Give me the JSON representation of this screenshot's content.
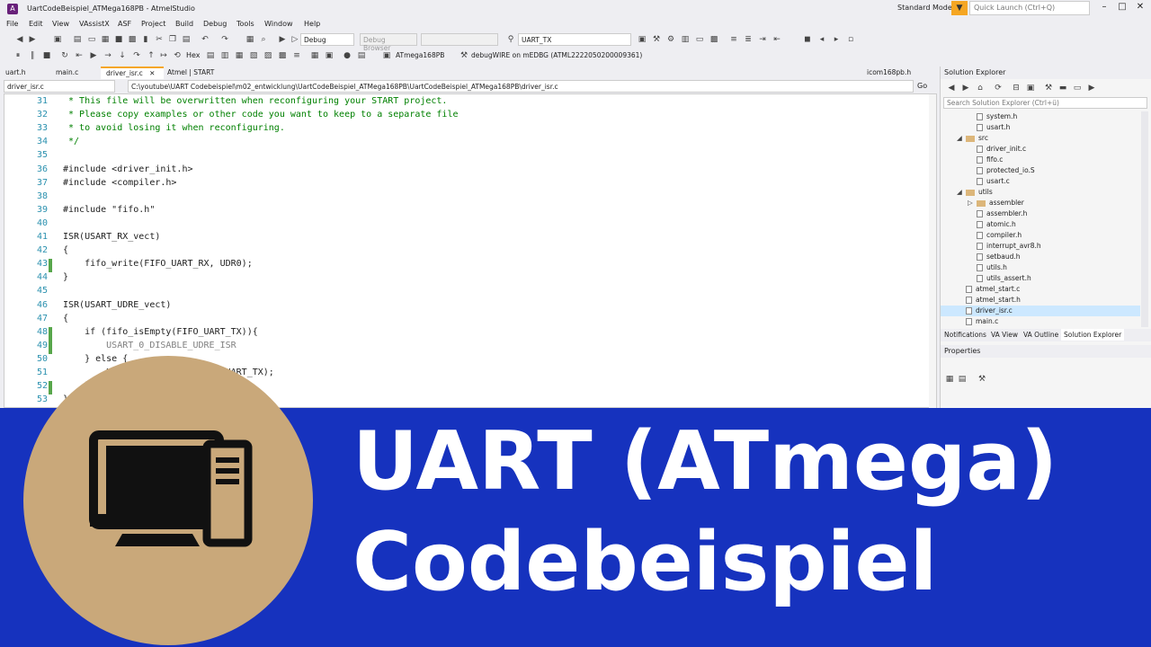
{
  "titlebar": {
    "logo": "A",
    "title": "UartCodeBeispiel_ATMega168PB - AtmelStudio",
    "mode": "Standard Mode",
    "quick_launch_placeholder": "Quick Launch (Ctrl+Q)"
  },
  "menu": [
    "File",
    "Edit",
    "View",
    "VAssistX",
    "ASF",
    "Project",
    "Build",
    "Debug",
    "Tools",
    "Window",
    "Help"
  ],
  "toolbar": {
    "config": "Debug",
    "debug_browser": "Debug Browser",
    "symbol": "UART_TX",
    "hex": "Hex",
    "device": "ATmega168PB",
    "tool": "debugWIRE on mEDBG (ATML2222050200009361)"
  },
  "tabs": [
    "uart.h",
    "main.c",
    "driver_isr.c",
    "Atmel | START",
    "icom168pb.h"
  ],
  "navbar": {
    "scope": "driver_isr.c",
    "path": "C:\\youtube\\UART Codebeispiel\\m02_entwicklung\\UartCodeBeispiel_ATMega168PB\\UartCodeBeispiel_ATMega168PB\\driver_isr.c",
    "go": "Go"
  },
  "code": [
    {
      "n": "31",
      "t": " * This file will be overwritten when reconfiguring your START project.",
      "c": "cm"
    },
    {
      "n": "32",
      "t": " * Please copy examples or other code you want to keep to a separate file",
      "c": "cm"
    },
    {
      "n": "33",
      "t": " * to avoid losing it when reconfiguring.",
      "c": "cm"
    },
    {
      "n": "34",
      "t": " */",
      "c": "cm"
    },
    {
      "n": "35",
      "t": "",
      "c": ""
    },
    {
      "n": "36",
      "t": "#include <driver_init.h>",
      "c": ""
    },
    {
      "n": "37",
      "t": "#include <compiler.h>",
      "c": ""
    },
    {
      "n": "38",
      "t": "",
      "c": ""
    },
    {
      "n": "39",
      "t": "#include \"fifo.h\"",
      "c": ""
    },
    {
      "n": "40",
      "t": "",
      "c": ""
    },
    {
      "n": "41",
      "t": "ISR(USART_RX_vect)",
      "c": ""
    },
    {
      "n": "42",
      "t": "{",
      "c": ""
    },
    {
      "n": "43",
      "t": "    fifo_write(FIFO_UART_RX, UDR0);",
      "c": ""
    },
    {
      "n": "44",
      "t": "}",
      "c": ""
    },
    {
      "n": "45",
      "t": "",
      "c": ""
    },
    {
      "n": "46",
      "t": "ISR(USART_UDRE_vect)",
      "c": ""
    },
    {
      "n": "47",
      "t": "{",
      "c": ""
    },
    {
      "n": "48",
      "t": "    if (fifo_isEmpty(FIFO_UART_TX)){",
      "c": ""
    },
    {
      "n": "49",
      "t": "        USART_0_DISABLE_UDRE_ISR",
      "c": "pp"
    },
    {
      "n": "50",
      "t": "    } else {",
      "c": ""
    },
    {
      "n": "51",
      "t": "        UDR0 = fifo_read(FIFO_UART_TX);",
      "c": ""
    },
    {
      "n": "52",
      "t": "    }",
      "c": ""
    },
    {
      "n": "53",
      "t": "}",
      "c": ""
    }
  ],
  "solution": {
    "title": "Solution Explorer",
    "search_placeholder": "Search Solution Explorer (Ctrl+ü)",
    "items": [
      {
        "label": "system.h",
        "type": "file",
        "indent": 3
      },
      {
        "label": "usart.h",
        "type": "file",
        "indent": 3
      },
      {
        "label": "src",
        "type": "folder",
        "indent": 2,
        "open": true
      },
      {
        "label": "driver_init.c",
        "type": "file",
        "indent": 3
      },
      {
        "label": "fifo.c",
        "type": "file",
        "indent": 3
      },
      {
        "label": "protected_io.S",
        "type": "file",
        "indent": 3
      },
      {
        "label": "usart.c",
        "type": "file",
        "indent": 3
      },
      {
        "label": "utils",
        "type": "folder",
        "indent": 2,
        "open": true
      },
      {
        "label": "assembler",
        "type": "folder",
        "indent": 3,
        "open": false
      },
      {
        "label": "assembler.h",
        "type": "file",
        "indent": 3
      },
      {
        "label": "atomic.h",
        "type": "file",
        "indent": 3
      },
      {
        "label": "compiler.h",
        "type": "file",
        "indent": 3
      },
      {
        "label": "interrupt_avr8.h",
        "type": "file",
        "indent": 3
      },
      {
        "label": "setbaud.h",
        "type": "file",
        "indent": 3
      },
      {
        "label": "utils.h",
        "type": "file",
        "indent": 3
      },
      {
        "label": "utils_assert.h",
        "type": "file",
        "indent": 3
      },
      {
        "label": "atmel_start.c",
        "type": "file",
        "indent": 2
      },
      {
        "label": "atmel_start.h",
        "type": "file",
        "indent": 2
      },
      {
        "label": "driver_isr.c",
        "type": "file",
        "indent": 2,
        "selected": true
      },
      {
        "label": "main.c",
        "type": "file",
        "indent": 2
      }
    ],
    "bottom_tabs": [
      "Notifications",
      "VA View",
      "VA Outline",
      "Solution Explorer"
    ],
    "properties_title": "Properties"
  },
  "banner": {
    "line1": "UART (ATmega)",
    "line2": "Codebeispiel",
    "icon": "computer-icon"
  },
  "colors": {
    "banner": "#1632be",
    "circle": "#c9a87a",
    "accent": "#f5a623"
  }
}
